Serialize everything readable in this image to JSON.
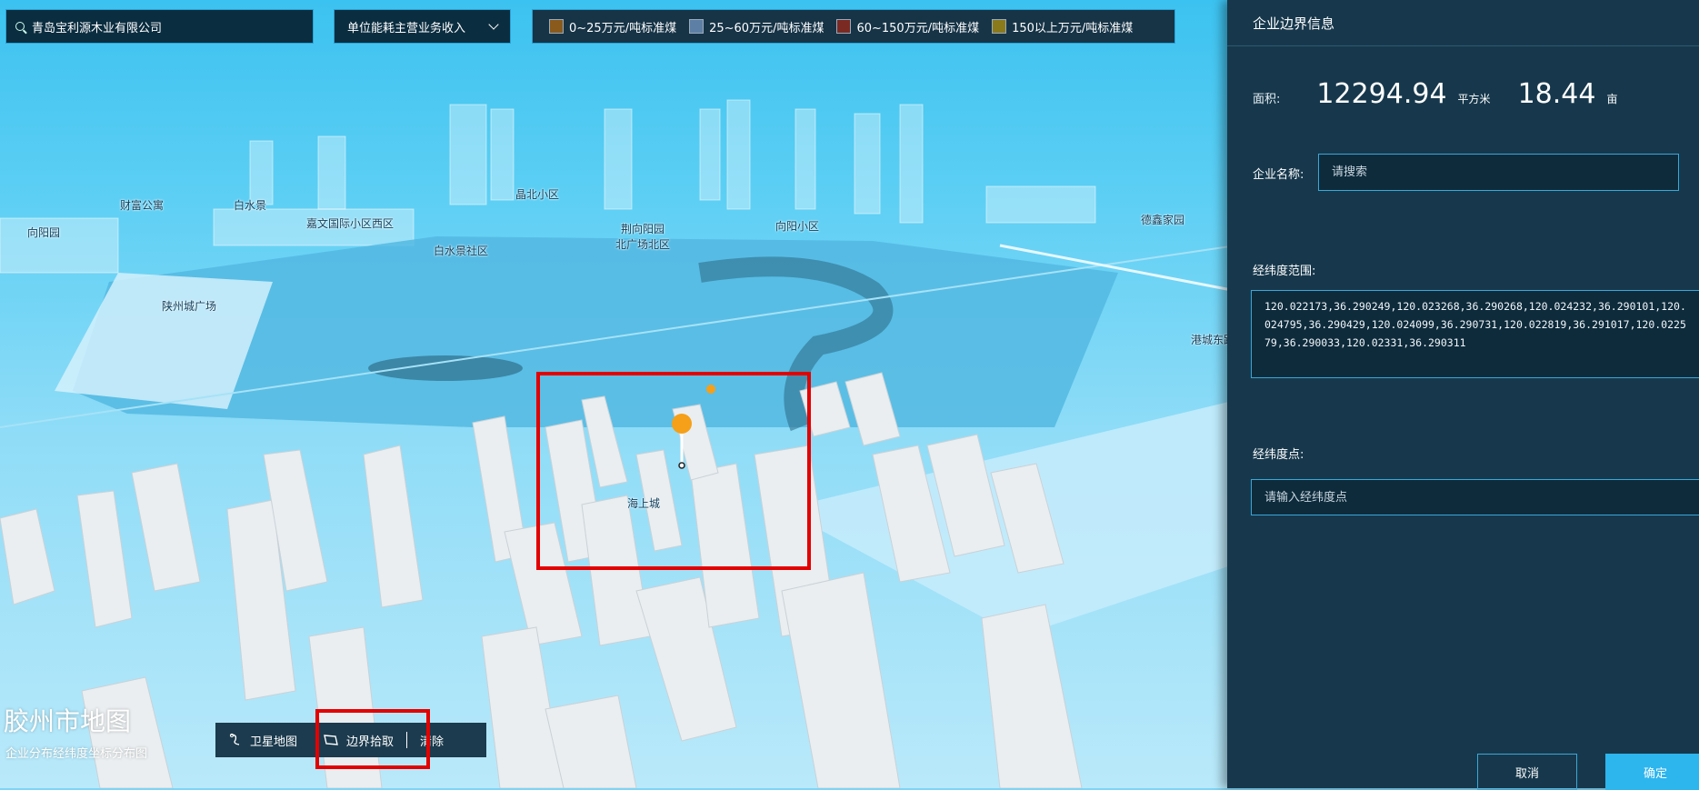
{
  "top_bar": {
    "search_value": "青岛宝利源木业有限公司",
    "dropdown_label": "单位能耗主营业务收入",
    "legend": [
      {
        "label": "0~25万元/吨标准煤",
        "color": "#8a5a1c"
      },
      {
        "label": "25~60万元/吨标准煤",
        "color": "#5d7fa6"
      },
      {
        "label": "60~150万元/吨标准煤",
        "color": "#7a2a22"
      },
      {
        "label": "150以上万元/吨标准煤",
        "color": "#8a7a1c"
      }
    ]
  },
  "map": {
    "title": "胶州市地图",
    "subtitle": "企业分布经纬度坐标分布图",
    "labels": [
      "财富公寓",
      "白水景",
      "晶北小区",
      "向阳园",
      "嘉文国际小区西区",
      "白水景社区",
      "荆向阳园",
      "北广场北区",
      "向阳小区",
      "德鑫家园",
      "陕州城广场",
      "港城东路",
      "海上城"
    ]
  },
  "toolbar": {
    "satellite_label": "卫星地图",
    "boundary_label": "边界拾取",
    "clear_label": "清除"
  },
  "panel": {
    "title": "企业边界信息",
    "area_label": "面积:",
    "area_sqm": "12294.94",
    "area_sqm_unit": "平方米",
    "area_mu": "18.44",
    "area_mu_unit": "亩",
    "company_label": "企业名称:",
    "company_placeholder": "请搜索",
    "range_label": "经纬度范围:",
    "range_value": "120.022173,36.290249,120.023268,36.290268,120.024232,36.290101,120.024795,36.290429,120.024099,36.290731,120.022819,36.291017,120.022579,36.290033,120.02331,36.290311",
    "point_label": "经纬度点:",
    "point_placeholder": "请输入经纬度点",
    "cancel_label": "取消",
    "ok_label": "确定"
  }
}
